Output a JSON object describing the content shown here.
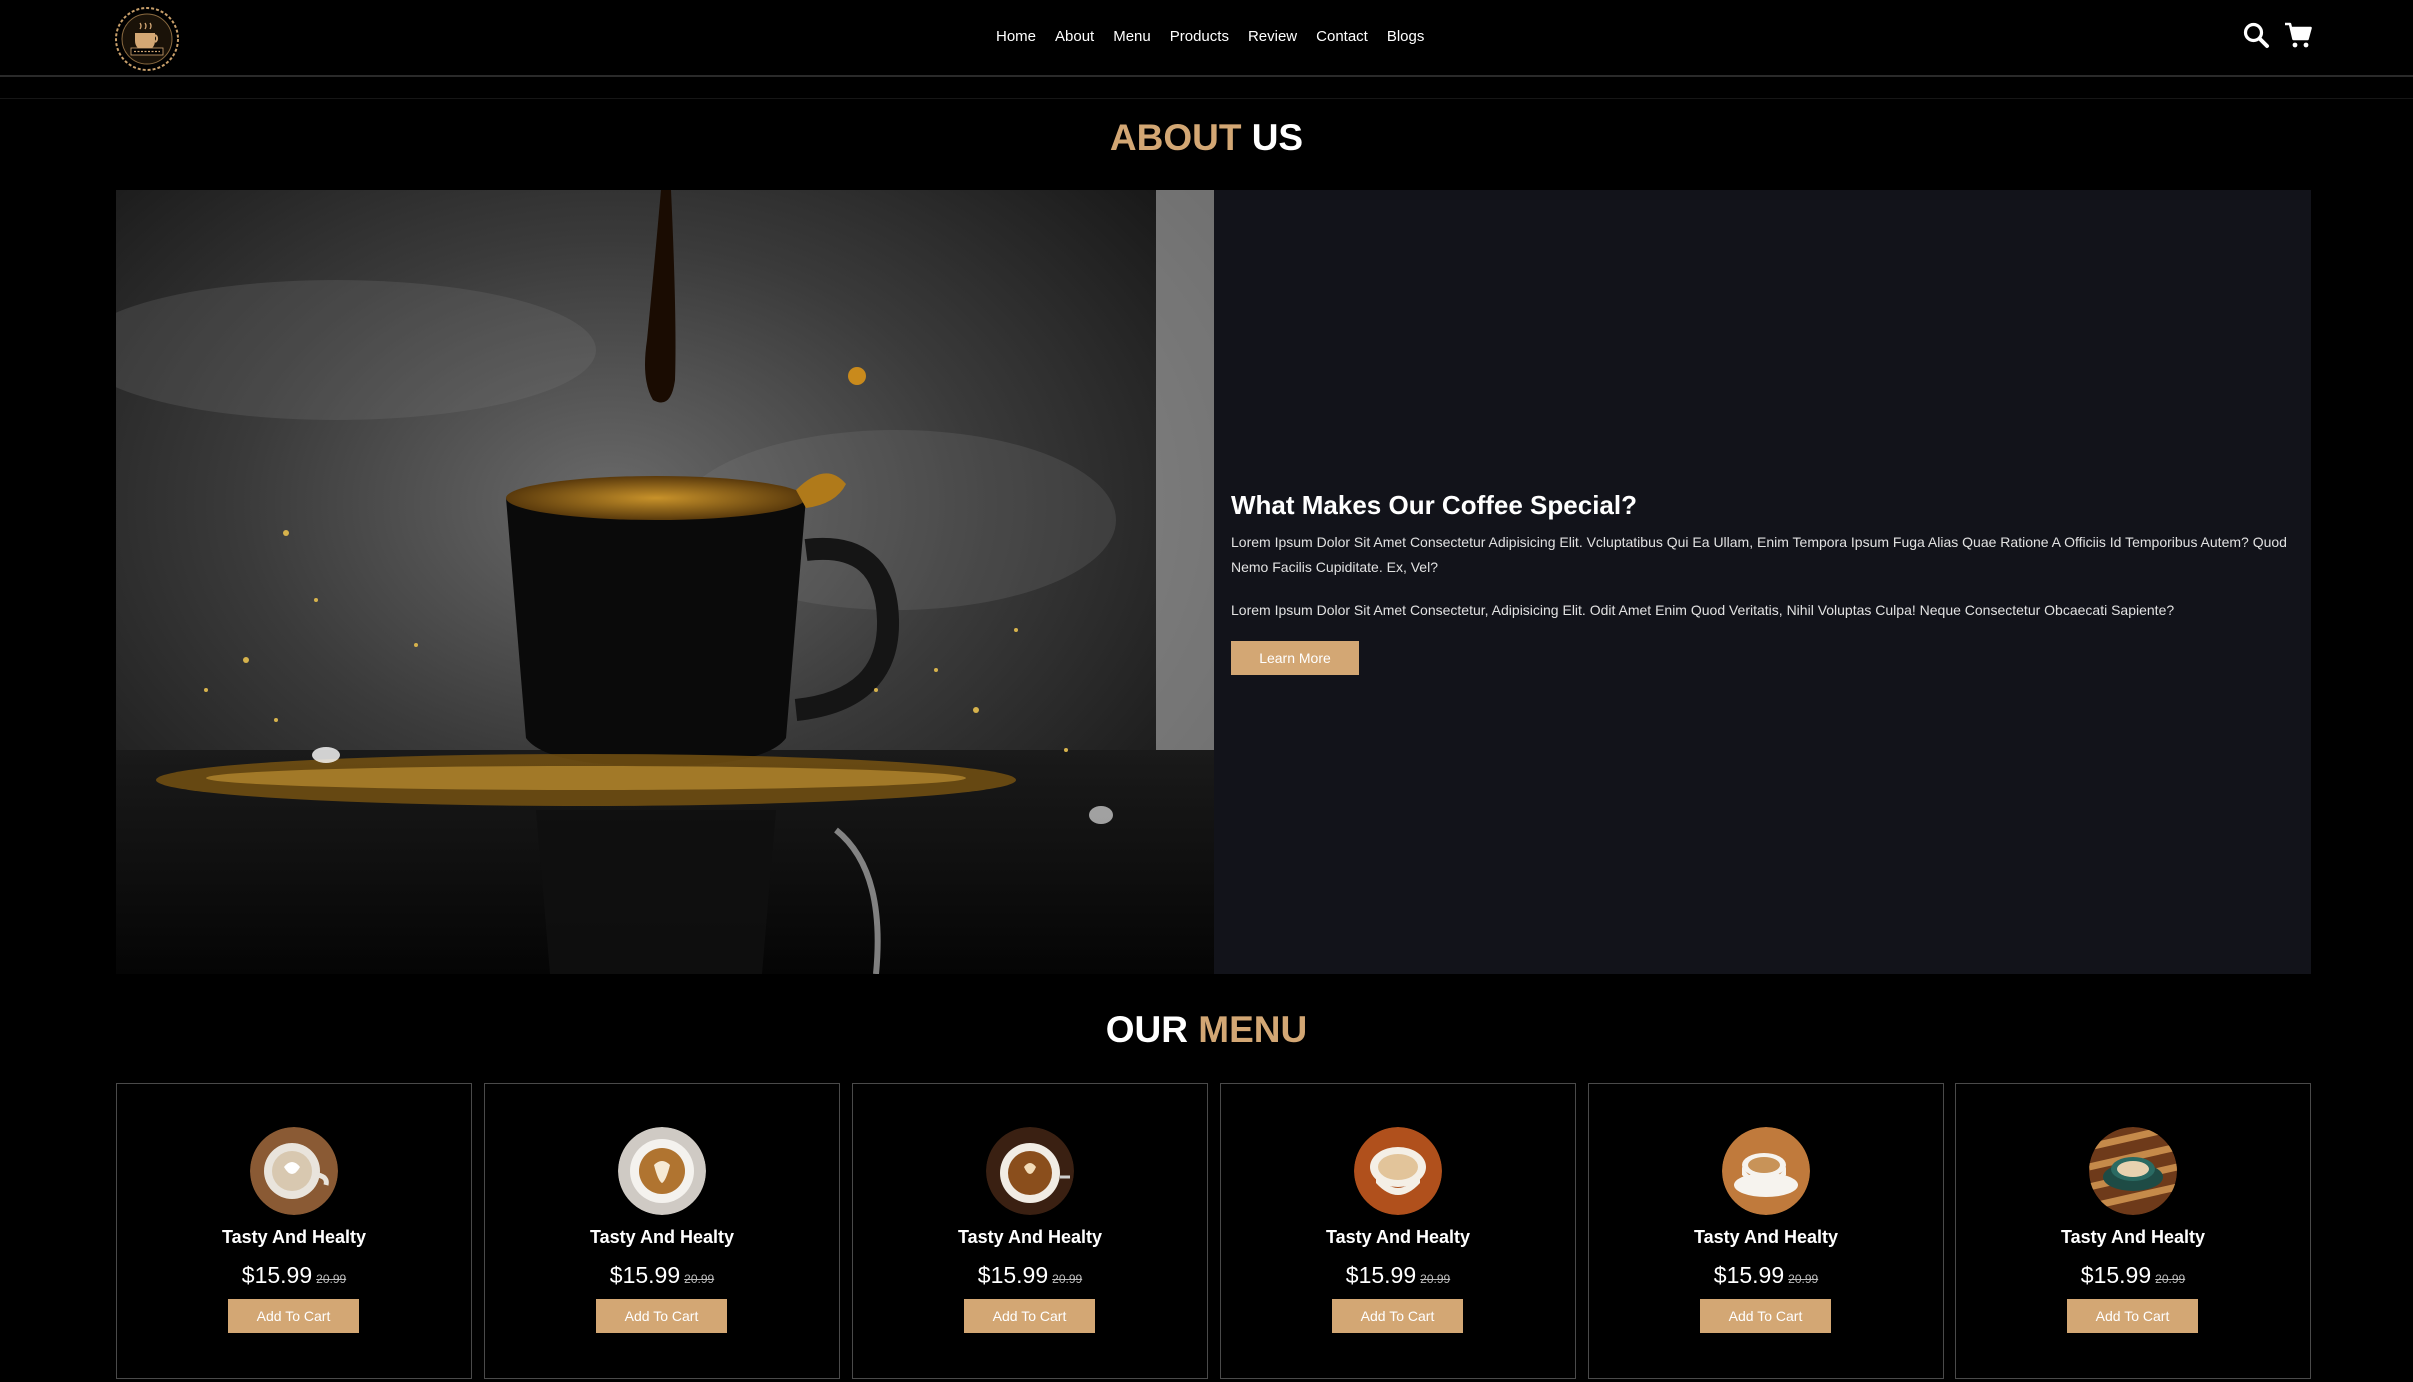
{
  "nav": {
    "links": [
      "Home",
      "About",
      "Menu",
      "Products",
      "Review",
      "Contact",
      "Blogs"
    ]
  },
  "icons": {
    "logo": "cafe-logo",
    "search": "search-icon",
    "cart": "cart-icon"
  },
  "about": {
    "title_accent": "ABOUT",
    "title_rest": "US",
    "heading": "What Makes Our Coffee Special?",
    "paragraph_1": "Lorem Ipsum Dolor Sit Amet Consectetur Adipisicing Elit. Vcluptatibus Qui Ea Ullam, Enim Tempora Ipsum Fuga Alias Quae Ratione A Officiis Id Temporibus Autem? Quod Nemo Facilis Cupiditate. Ex, Vel?",
    "paragraph_2": "Lorem Ipsum Dolor Sit Amet Consectetur, Adipisicing Elit. Odit Amet Enim Quod Veritatis, Nihil Voluptas Culpa! Neque Consectetur Obcaecati Sapiente?",
    "button_label": "Learn More"
  },
  "menu": {
    "title_rest": "OUR",
    "title_accent": "MENU",
    "items": [
      {
        "name": "Tasty And Healty",
        "price": "$15.99",
        "old_price": "20.99",
        "button": "Add To Cart"
      },
      {
        "name": "Tasty And Healty",
        "price": "$15.99",
        "old_price": "20.99",
        "button": "Add To Cart"
      },
      {
        "name": "Tasty And Healty",
        "price": "$15.99",
        "old_price": "20.99",
        "button": "Add To Cart"
      },
      {
        "name": "Tasty And Healty",
        "price": "$15.99",
        "old_price": "20.99",
        "button": "Add To Cart"
      },
      {
        "name": "Tasty And Healty",
        "price": "$15.99",
        "old_price": "20.99",
        "button": "Add To Cart"
      },
      {
        "name": "Tasty And Healty",
        "price": "$15.99",
        "old_price": "20.99",
        "button": "Add To Cart"
      }
    ]
  },
  "colors": {
    "accent": "#d3a774",
    "background": "#000000",
    "panel": "#12131a"
  }
}
